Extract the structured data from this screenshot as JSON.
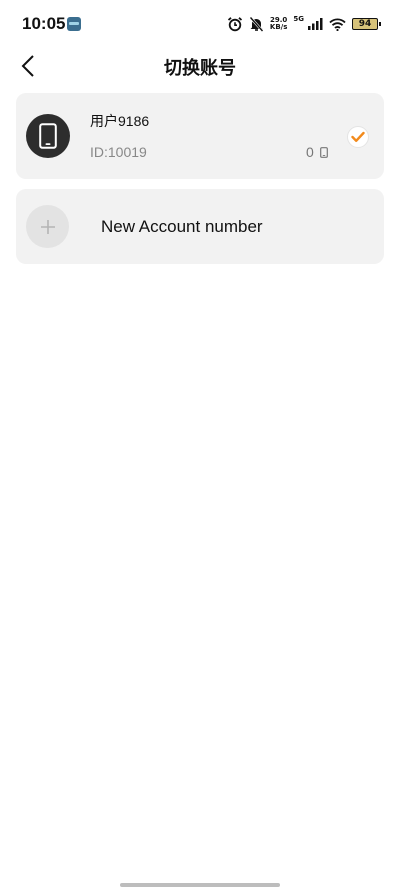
{
  "status_bar": {
    "time": "10:05",
    "net_speed_value": "29.0",
    "net_speed_unit": "KB/s",
    "network_gen": "5G",
    "battery": "94"
  },
  "header": {
    "title": "切换账号"
  },
  "accounts": [
    {
      "name": "用户9186",
      "id_label": "ID:10019",
      "device_count": "0",
      "selected": true
    }
  ],
  "new_account": {
    "label": "New Account number"
  },
  "icons": {
    "back": "chevron-left-icon",
    "avatar": "phone-icon",
    "device": "small-phone-icon",
    "selected": "check-icon",
    "add": "plus-icon"
  },
  "colors": {
    "card_bg": "#f2f2f2",
    "check_accent": "#f28a1c",
    "avatar_bg": "#2d2d2d"
  }
}
